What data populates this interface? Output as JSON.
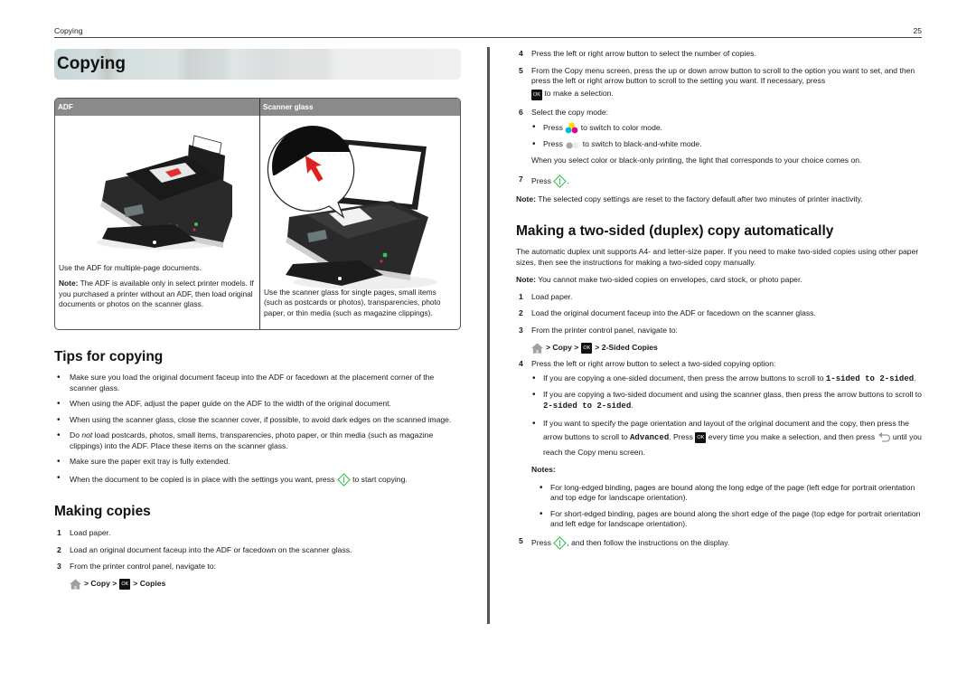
{
  "header": {
    "section_title": "Copying",
    "page_number": "25"
  },
  "left": {
    "chapter_title": "Copying",
    "compare_table": {
      "headers": [
        "ADF",
        "Scanner glass"
      ],
      "adf": {
        "image_alt": "Printer with original document loaded in ADF",
        "text": "Use the ADF for multiple-page documents.",
        "note_label": "Note:",
        "note_text": " The ADF is available only in select printer models. If you purchased a printer without an ADF, then load original documents or photos on the scanner glass."
      },
      "scanner_glass": {
        "image_alt": "Printer with open scanner lid and document on scanner glass",
        "text": "Use the scanner glass for single pages, small items (such as postcards or photos), transparencies, photo paper, or thin media (such as magazine clippings)."
      }
    },
    "tips": {
      "heading": "Tips for copying",
      "items": [
        "Make sure you load the original document faceup into the ADF or facedown at the placement corner of the scanner glass.",
        "When using the ADF, adjust the paper guide on the ADF to the width of the original document.",
        "When using the scanner glass, close the scanner cover, if possible, to avoid dark edges on the scanned image."
      ],
      "item4_pre": "Do ",
      "item4_em": "not",
      "item4_post": " load postcards, photos, small items, transparencies, photo paper, or thin media (such as magazine clippings) into the ADF. Place these items on the scanner glass.",
      "item5": "Make sure the paper exit tray is fully extended.",
      "item6_pre": "When the document to be copied is in place with the settings you want, press ",
      "item6_post": " to start copying."
    },
    "making_copies": {
      "heading": "Making copies",
      "steps": [
        {
          "num": "1",
          "text": "Load paper."
        },
        {
          "num": "2",
          "text": "Load an original document faceup into the ADF or facedown on the scanner glass."
        },
        {
          "num": "3",
          "text": "From the printer control panel, navigate to:"
        }
      ],
      "nav": {
        "sep1": "> Copy >",
        "ok": "OK",
        "sep2": "> Copies"
      }
    }
  },
  "right": {
    "cont_steps": {
      "step4_num": "4",
      "step4": "Press the left or right arrow button to select the number of copies.",
      "step5_num": "5",
      "step5_pre": "From the Copy menu screen, press the up or down arrow button to scroll to the option you want to set, and then press the left or right arrow button to scroll to the setting you want. If necessary, press",
      "step5_post": " to make a selection.",
      "step6_num": "6",
      "step6": "Select the copy mode:",
      "step6_b1_pre": "Press ",
      "step6_b1_post": " to switch to color mode.",
      "step6_b2_pre": "Press ",
      "step6_b2_post": " to switch to black-and-white mode.",
      "step6_after": "When you select color or black-only printing, the light that corresponds to your choice comes on.",
      "step7_num": "7",
      "step7_pre": "Press ",
      "step7_post": ".",
      "note_label": "Note:",
      "note_text": " The selected copy settings are reset to the factory default after two minutes of printer inactivity."
    },
    "duplex": {
      "heading": "Making a two-sided (duplex) copy automatically",
      "intro": "The automatic duplex unit supports A4- and letter-size paper. If you need to make two-sided copies using other paper sizes, then see the instructions for making a two-sided copy manually.",
      "note_label": "Note:",
      "note_text": " You cannot make two-sided copies on envelopes, card stock, or photo paper.",
      "steps": [
        {
          "num": "1",
          "text": "Load paper."
        },
        {
          "num": "2",
          "text": "Load the original document faceup into the ADF or facedown on the scanner glass."
        },
        {
          "num": "3",
          "text": "From the printer control panel, navigate to:"
        }
      ],
      "nav": {
        "sep1": "> Copy >",
        "ok": "OK",
        "sep2": "> 2-Sided Copies"
      },
      "step4_num": "4",
      "step4": "Press the left or right arrow button to select a two-sided copying option:",
      "opt1_pre": "If you are copying a one-sided document, then press the arrow buttons to scroll to ",
      "opt1_code": "1-sided to 2-sided",
      "opt1_post": ".",
      "opt2_pre": "If you are copying a two-sided document and using the scanner glass, then press the arrow buttons to scroll to ",
      "opt2_code": "2-sided to 2-sided",
      "opt2_post": ".",
      "opt3_pre": "If you want to specify the page orientation and layout of the original document and the copy, then press the arrow buttons to scroll to ",
      "opt3_code": "Advanced",
      "opt3_mid": ". Press ",
      "opt3_mid2": " every time you make a selection, and then press ",
      "opt3_post": " until you reach the Copy menu screen.",
      "notes_label": "Notes:",
      "notes": [
        "For long-edged binding, pages are bound along the long edge of the page (left edge for portrait orientation and top edge for landscape orientation).",
        "For short-edged binding, pages are bound along the short edge of the page (top edge for portrait orientation and left edge for landscape orientation)."
      ],
      "step5_num": "5",
      "step5_pre": "Press ",
      "step5_post": ", and then follow the instructions on the display."
    }
  },
  "colors": {
    "start_green": "#3cc35a",
    "table_header": "#8a8a8a",
    "ok_black": "#111111"
  }
}
